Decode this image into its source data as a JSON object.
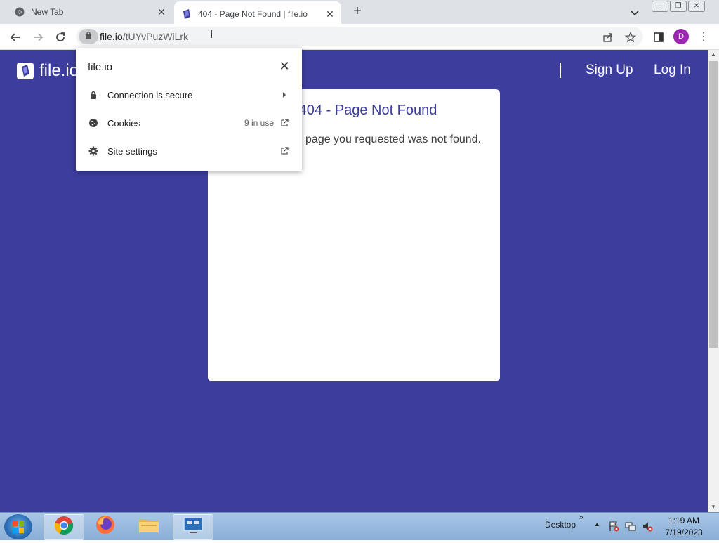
{
  "browser": {
    "tabs": [
      {
        "title": "New Tab",
        "icon": "chrome-icon",
        "active": false
      },
      {
        "title": "404 - Page Not Found | file.io",
        "icon": "fileio-favicon",
        "active": true
      }
    ],
    "address": {
      "host": "file.io",
      "path": "/tUYvPuzWiLrk"
    },
    "avatar_letter": "D"
  },
  "site_info_popup": {
    "host": "file.io",
    "rows": [
      {
        "icon": "lock-icon",
        "label": "Connection is secure",
        "value": "",
        "trailing": "chevron-right-icon"
      },
      {
        "icon": "cookie-icon",
        "label": "Cookies",
        "value": "9 in use",
        "trailing": "open-in-new-icon"
      },
      {
        "icon": "gear-icon",
        "label": "Site settings",
        "value": "",
        "trailing": "open-in-new-icon"
      }
    ]
  },
  "page": {
    "logo_text": "file.io",
    "nav": {
      "signup": "Sign Up",
      "login": "Log In"
    },
    "card": {
      "title": "404 - Page Not Found",
      "message": "The page you requested was not found."
    },
    "colors": {
      "background": "#3d3d9e",
      "card": "#ffffff",
      "title": "#3d3d9e"
    }
  },
  "taskbar": {
    "apps": [
      "chrome-icon",
      "firefox-icon",
      "file-explorer-icon",
      "remote-desktop-icon"
    ],
    "desktop_label": "Desktop",
    "clock": {
      "time": "1:19 AM",
      "date": "7/19/2023"
    }
  }
}
